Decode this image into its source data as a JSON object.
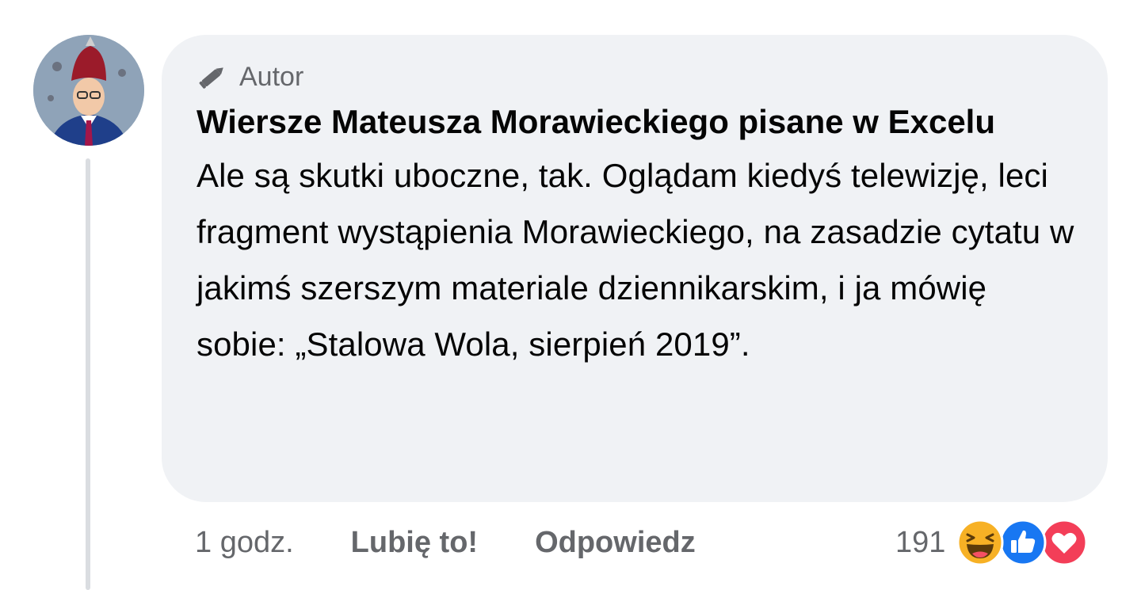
{
  "comment": {
    "badge": {
      "icon": "pencil-icon",
      "label": "Autor"
    },
    "author": "Wiersze Mateusza Morawieckiego pisane w Excelu",
    "text": "Ale są skutki uboczne, tak. Oglądam kiedyś telewizję, leci fragment wystąpienia Morawieckiego, na zasadzie cytatu w jakimś szerszym materiale dziennikarskim, i ja mówię sobie: „Stalowa Wola, sierpień 2019”.",
    "time": "1 godz.",
    "like_label": "Lubię to!",
    "reply_label": "Odpowiedz",
    "reaction_count": "191",
    "reactions": [
      "haha-icon",
      "like-icon",
      "love-icon"
    ]
  },
  "colors": {
    "bubble": "#f0f2f5",
    "text": "#050505",
    "secondary": "#65676b",
    "like_blue": "#1877f2",
    "love_red": "#f33e58",
    "haha_yellow": "#f7b125"
  }
}
